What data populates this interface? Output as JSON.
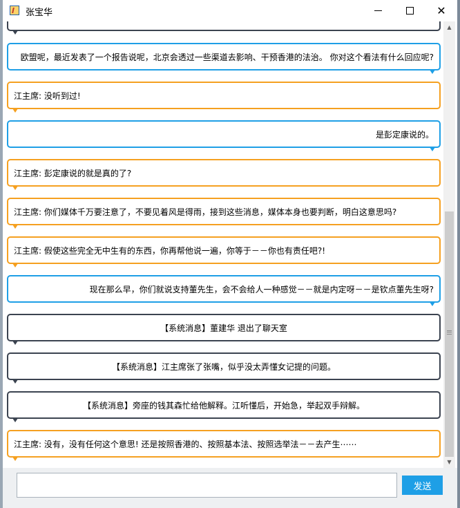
{
  "window": {
    "title": "张宝华"
  },
  "messages": [
    {
      "type": "gray",
      "text": ""
    },
    {
      "type": "blue",
      "text": "欧盟呢，最近发表了一个报告说呢，北京会透过一些渠道去影响、干预香港的法治。 你对这个看法有什么回应呢?"
    },
    {
      "type": "orange",
      "text": "江主席: 没听到过!"
    },
    {
      "type": "blue",
      "text": "是彭定康说的。"
    },
    {
      "type": "orange",
      "text": "江主席: 彭定康说的就是真的了?"
    },
    {
      "type": "orange",
      "text": "江主席: 你们媒体千万要注意了，不要见着风是得雨，接到这些消息，媒体本身也要判断，明白这意思吗?"
    },
    {
      "type": "orange",
      "text": "江主席: 假使这些完全无中生有的东西，你再帮他说一遍，你等于－－你也有责任吧?!"
    },
    {
      "type": "blue",
      "text": "现在那么早，你们就说支持董先生，会不会给人一种感觉－－就是内定呀－－是钦点董先生呀?"
    },
    {
      "type": "gray",
      "text": "【系统消息】董建华 退出了聊天室"
    },
    {
      "type": "gray",
      "text": "【系统消息】江主席张了张嘴，似乎没太弄懂女记提的问题。"
    },
    {
      "type": "gray",
      "text": "【系统消息】旁座的钱其森忙给他解释。江听懂后，开始急，举起双手辩解。"
    },
    {
      "type": "orange",
      "text": "江主席: 没有，没有任何这个意思! 还是按照香港的、按照基本法、按照选举法－－去产生⋯⋯"
    }
  ],
  "input": {
    "value": "",
    "placeholder": ""
  },
  "send_button": {
    "label": "发送"
  },
  "colors": {
    "reporter_border": "#1e9fe6",
    "jiang_border": "#f5a020",
    "system_border": "#3b4350",
    "send_button_bg": "#1e9fe6"
  },
  "icons": [
    "app-icon",
    "minimize-icon",
    "maximize-icon",
    "close-icon",
    "scroll-up-arrow-icon",
    "scroll-down-arrow-icon"
  ]
}
